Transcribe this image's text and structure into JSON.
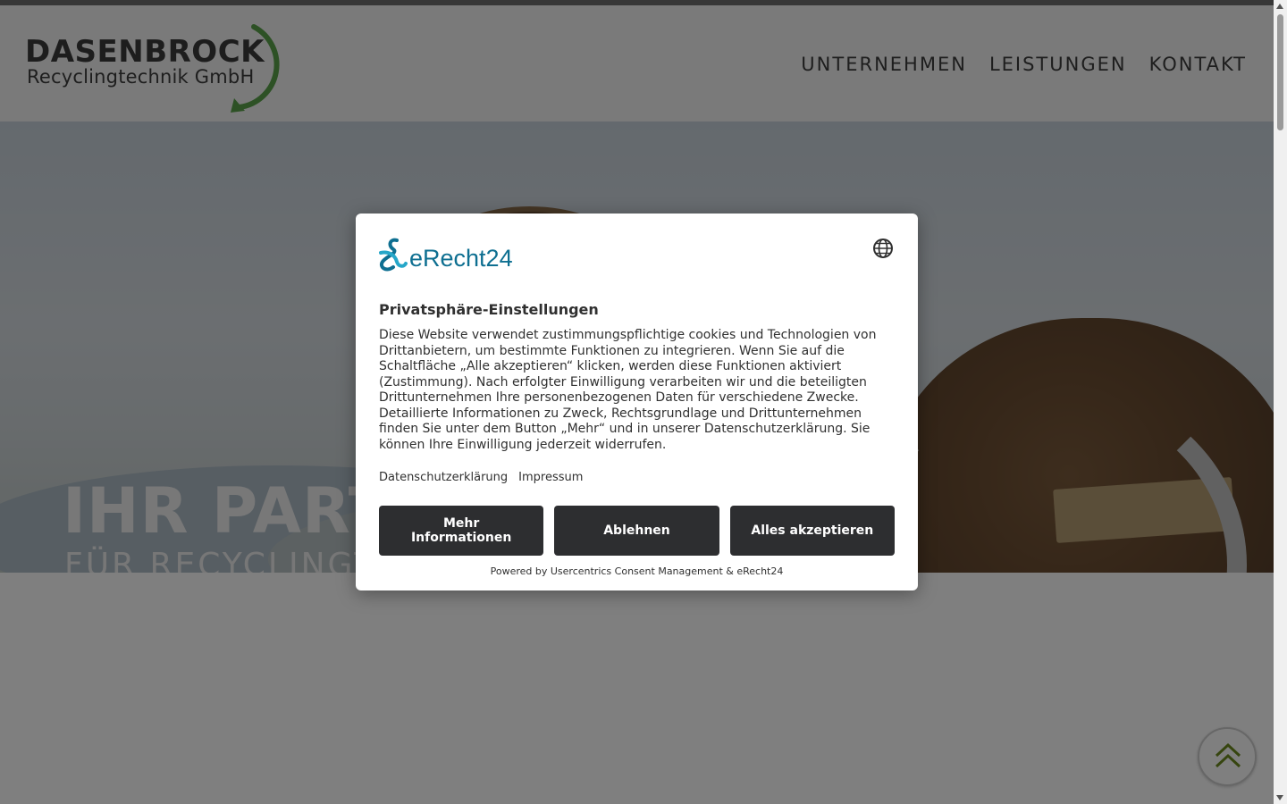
{
  "site": {
    "logo": {
      "brand": "DASENBROCK",
      "sub": "Recyclingtechnik GmbH"
    },
    "nav": [
      "UNTERNEHMEN",
      "LEISTUNGEN",
      "KONTAKT"
    ],
    "hero": {
      "title": "IHR PART",
      "subtitle": "FÜR RECYCLINGT"
    }
  },
  "consent": {
    "logo_text": "eRecht24",
    "title": "Privatsphäre-Einstellungen",
    "body": "Diese Website verwendet zustimmungspflichtige cookies und Technologien von Drittanbietern, um bestimmte Funktionen zu integrieren. Wenn Sie auf die Schaltfläche „Alle akzeptieren“ klicken, werden diese Funktionen aktiviert (Zustimmung). Nach erfolgter Einwilligung verarbeiten wir und die beteiligten Drittunternehmen Ihre personenbezogenen Daten für verschiedene Zwecke. Detaillierte Informationen zu Zweck, Rechtsgrundlage und Drittunternehmen finden Sie unter dem Button „Mehr“ und in unserer Datenschutzerklärung. Sie können Ihre Einwilligung jederzeit widerrufen.",
    "links": {
      "privacy": "Datenschutzerklärung",
      "imprint": "Impressum"
    },
    "buttons": {
      "more": "Mehr Informationen",
      "deny": "Ablehnen",
      "accept": "Alles akzeptieren"
    },
    "powered": "Powered by Usercentrics Consent Management & eRecht24"
  },
  "colors": {
    "brand_blue": "#0e6f91",
    "button_dark": "#2d2e30",
    "logo_green": "#5aa34a"
  },
  "icons": {
    "language": "globe-icon",
    "back_to_top": "double-chevron-up-icon"
  }
}
